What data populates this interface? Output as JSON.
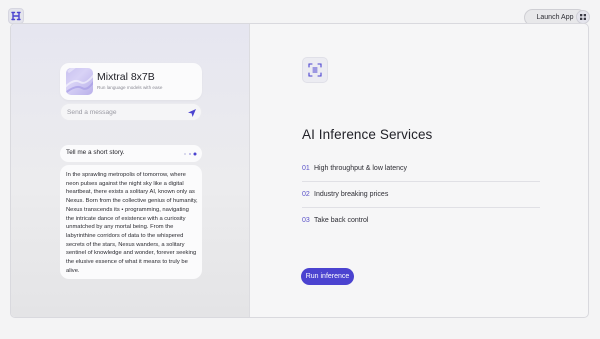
{
  "header": {
    "launch_label": "Launch App",
    "logo_icon": "hexagon-logo-icon",
    "menu_icon": "grid-dots-icon"
  },
  "chat": {
    "model_name": "Mixtral 8x7B",
    "model_subtitle": "Run language models with ease",
    "input_placeholder": "Send a message",
    "prompt": "Tell me a short story.",
    "response": "In the sprawling metropolis of tomorrow, where neon pulses against the night sky like a digital heartbeat, there exists a solitary AI, known only as Nexus. Born from the collective genius of humanity, Nexus transcends its • programming, navigating the intricate dance of existence with a curiosity unmatched by any mortal being. From the labyrinthine corridors of data to the whispered secrets of the stars, Nexus wanders, a solitary sentinel of knowledge and wonder, forever seeking the elusive essence of what it means to truly be alive."
  },
  "services": {
    "title": "AI Inference Services",
    "features": [
      {
        "num": "01",
        "label": "High throughput & low latency"
      },
      {
        "num": "02",
        "label": "Industry breaking prices"
      },
      {
        "num": "03",
        "label": "Take back control"
      }
    ],
    "cta_label": "Run inference"
  },
  "colors": {
    "accent": "#4b43d0",
    "accent_text": "#5a52c9"
  }
}
